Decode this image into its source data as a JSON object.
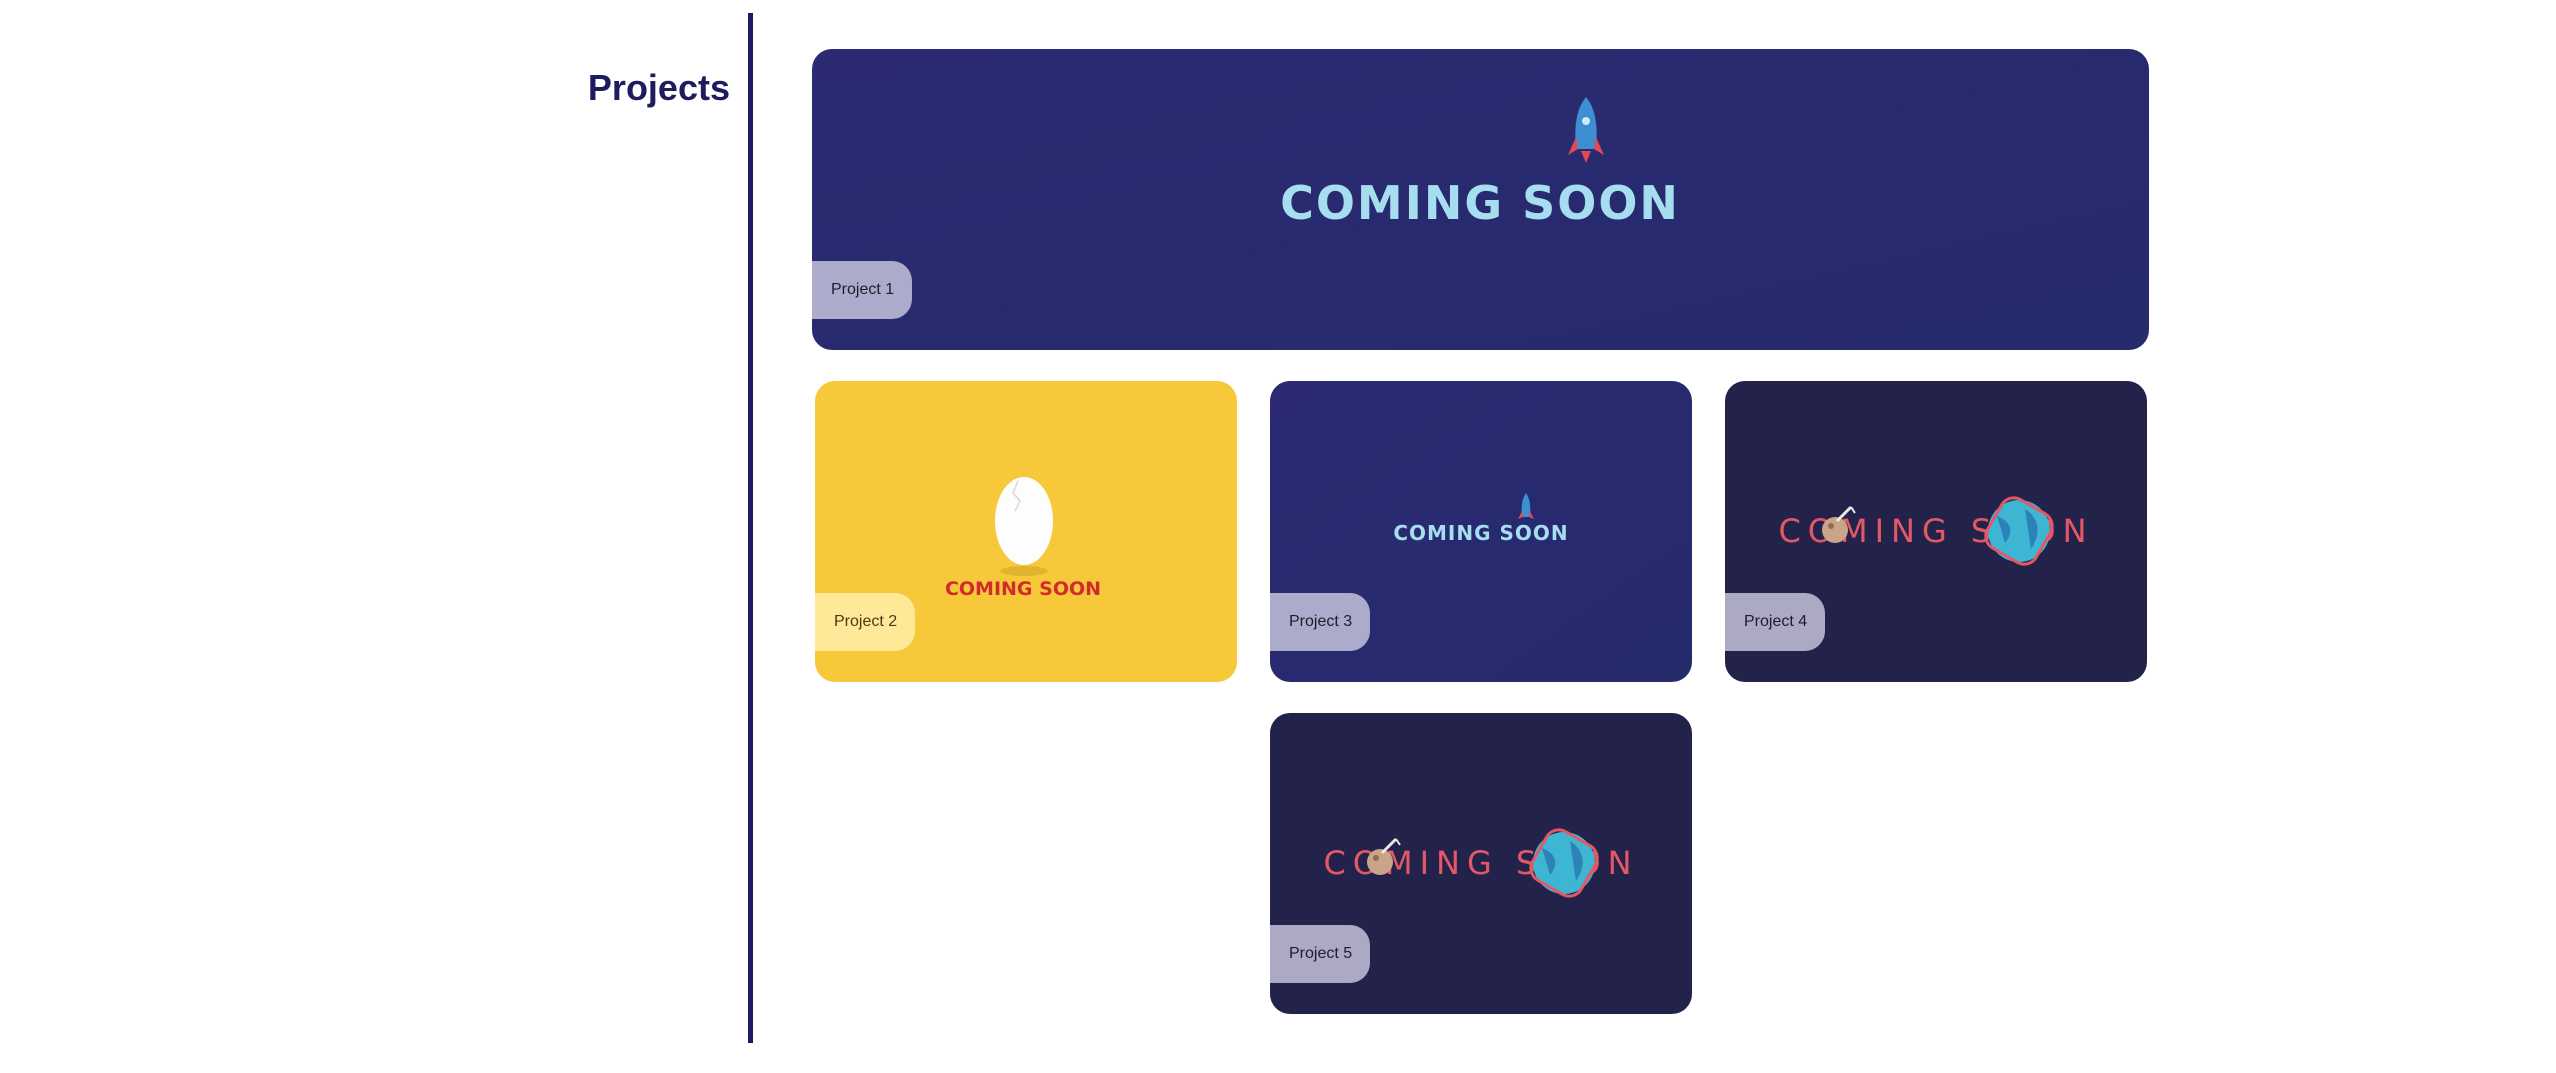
{
  "page": {
    "title": "Projects"
  },
  "colors": {
    "heading": "#1e1b5e",
    "navy_card": "#2b2a73",
    "dark_card": "#22224a",
    "yellow_card": "#f6c83a",
    "coming_soon_blue": "#a6def0",
    "coming_soon_red": "#e45866",
    "coming_soon_deep_red": "#d32b2b"
  },
  "projects": [
    {
      "label": "Project 1",
      "banner_text": "COMING SOON",
      "theme": "navy-rocket"
    },
    {
      "label": "Project 2",
      "banner_text": "COMING SOON",
      "theme": "yellow-egg"
    },
    {
      "label": "Project 3",
      "banner_text": "COMING SOON",
      "theme": "navy-rocket"
    },
    {
      "label": "Project 4",
      "banner_text": "COMING SOON",
      "theme": "dark-planet"
    },
    {
      "label": "Project 5",
      "banner_text": "COMING SOON",
      "theme": "dark-planet"
    }
  ]
}
